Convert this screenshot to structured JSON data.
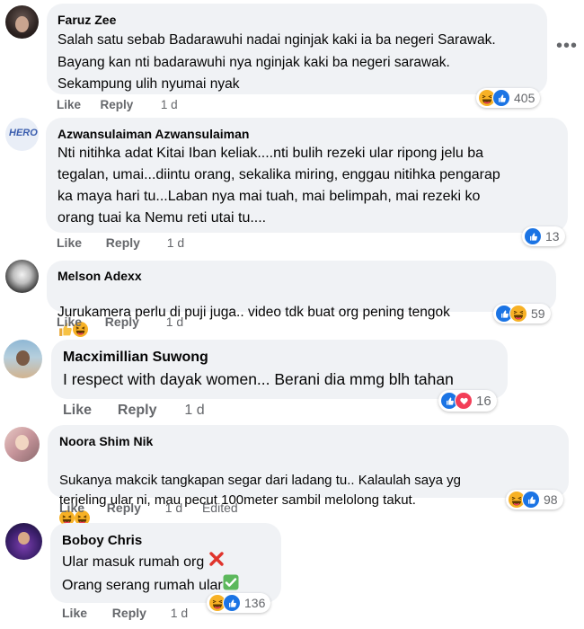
{
  "comments": [
    {
      "author": "Faruz Zee",
      "text": "Salah satu sebab Badarawuhi nadai nginjak kaki ia ba negeri Sarawak.\nBayang kan nti badarawuhi nya nginjak kaki ba negeri sarawak.\nSekampung ulih nyumai nyak",
      "like": "Like",
      "reply": "Reply",
      "time": "1 d",
      "count": "405",
      "reactions": [
        "haha",
        "like"
      ]
    },
    {
      "author": "Azwansulaiman Azwansulaiman",
      "text": "Nti nitihka adat Kitai Iban keliak....nti bulih rezeki ular ripong jelu ba\ntegalan, umai...diintu orang, sekalika miring, enggau nitihka pengarap\nka maya hari tu...Laban nya mai tuah, mai belimpah, mai rezeki ko\norang tuai ka Nemu reti utai tu....",
      "like": "Like",
      "reply": "Reply",
      "time": "1 d",
      "count": "13",
      "reactions": [
        "like"
      ]
    },
    {
      "author": "Melson Adexx",
      "text": "Jurukamera perlu di puji juga.. video tdk buat org pening tengok",
      "like": "Like",
      "reply": "Reply",
      "time": "1 d",
      "count": "59",
      "reactions": [
        "like",
        "haha"
      ]
    },
    {
      "author": "Macximillian Suwong",
      "text": "I respect with dayak women... Berani dia mmg blh tahan",
      "like": "Like",
      "reply": "Reply",
      "time": "1 d",
      "count": "16",
      "reactions": [
        "like",
        "love"
      ]
    },
    {
      "author": "Noora Shim Nik",
      "text": "Sukanya makcik tangkapan segar dari ladang tu.. Kalaulah saya yg\nterjeling ular ni, mau pecut 100meter sambil melolong takut.",
      "like": "Like",
      "reply": "Reply",
      "time": "1 d",
      "edited": "Edited",
      "count": "98",
      "reactions": [
        "haha",
        "like"
      ]
    },
    {
      "author": "Boboy Chris",
      "line1": "Ular masuk rumah org",
      "line2": "Orang serang rumah ular",
      "like": "Like",
      "reply": "Reply",
      "time": "1 d",
      "count": "136",
      "reactions": [
        "haha",
        "like"
      ]
    }
  ],
  "icons": {
    "more": "more-options-icon",
    "cross": "red-cross-mark-icon",
    "check": "green-check-mark-icon",
    "thumbs": "thumbs-up-emoji-icon",
    "grin": "grinning-emoji-icon"
  },
  "colors": {
    "bubble": "#f0f2f5",
    "like_blue": "#1b74e4",
    "haha_yellow": "#f7b125",
    "love_red": "#f33e58",
    "meta_gray": "#65676b"
  }
}
